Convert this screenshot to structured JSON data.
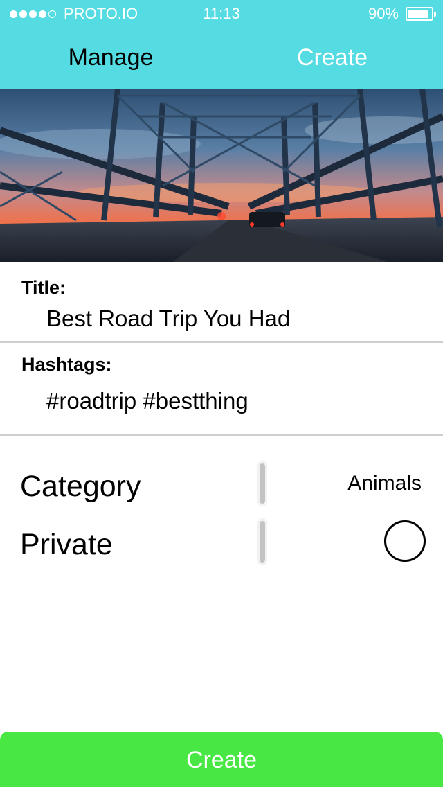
{
  "status_bar": {
    "carrier": "PROTO.IO",
    "time": "11:13",
    "battery": "90%",
    "battery_level": 0.9,
    "signal_bars_filled": 4,
    "signal_bars_total": 5
  },
  "nav": {
    "manage_label": "Manage",
    "create_label": "Create"
  },
  "hero": {
    "subject": "bridge-sunset-photo"
  },
  "form": {
    "title_label": "Title:",
    "title_value": "Best Road Trip You Had",
    "hashtags_label": "Hashtags:",
    "hashtags_value": "#roadtrip #bestthing",
    "category_label": "Category",
    "category_value": "Animals",
    "private_label": "Private",
    "private_on": false
  },
  "create_button_label": "Create",
  "colors": {
    "header": "#55dbe2",
    "button": "#48e744",
    "divider": "#cfcfcf"
  }
}
